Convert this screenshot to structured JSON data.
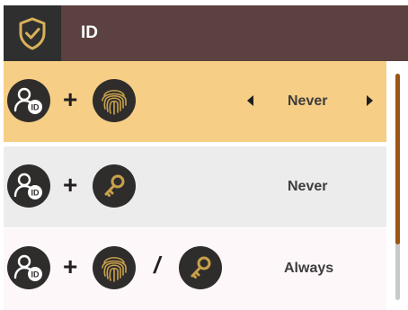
{
  "header": {
    "title": "ID",
    "icon": "shield-check-icon"
  },
  "rows": [
    {
      "factor1": "user-id-icon",
      "factor2": "fingerprint-icon",
      "value": "Never",
      "selected": true
    },
    {
      "factor1": "user-id-icon",
      "factor2": "key-icon",
      "value": "Never",
      "selected": false
    },
    {
      "factor1": "user-id-icon",
      "factor2": "fingerprint-icon",
      "factor3": "key-icon",
      "value": "Always",
      "selected": false
    }
  ],
  "colors": {
    "header_bg": "#5b4140",
    "header_icon_bg": "#2f2f2f",
    "selected_row": "#f6ce85",
    "accent": "#c8a14a",
    "scroll_thumb": "#9a5612"
  }
}
